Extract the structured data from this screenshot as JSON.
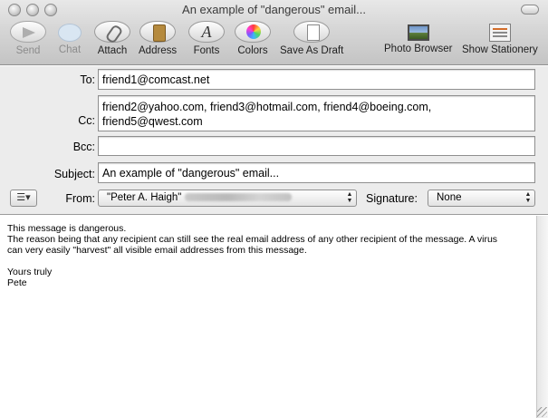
{
  "window": {
    "title": "An example of \"dangerous\" email..."
  },
  "toolbar": {
    "send": "Send",
    "chat": "Chat",
    "attach": "Attach",
    "address": "Address",
    "fonts": "Fonts",
    "colors": "Colors",
    "save_as_draft": "Save As Draft",
    "photo_browser": "Photo Browser",
    "show_stationery": "Show Stationery",
    "fonts_glyph": "A"
  },
  "fields": {
    "to_label": "To:",
    "to_value": "friend1@comcast.net",
    "cc_label": "Cc:",
    "cc_line1": "friend2@yahoo.com, friend3@hotmail.com, friend4@boeing.com,",
    "cc_line2": "friend5@qwest.com",
    "bcc_label": "Bcc:",
    "bcc_value": "",
    "subject_label": "Subject:",
    "subject_value": "An example of \"dangerous\" email...",
    "account_menu_glyph": "☰▾",
    "from_label": "From:",
    "from_value": "\"Peter A. Haigh\"",
    "signature_label": "Signature:",
    "signature_value": "None"
  },
  "message": {
    "line1": "This message is dangerous.",
    "line2": "The reason being that any recipient can still see the real email address of any other recipient of the message. A virus",
    "line3": "can very easily \"harvest\" all visible email addresses from this message.",
    "line4": "Yours truly",
    "line5": "Pete"
  }
}
